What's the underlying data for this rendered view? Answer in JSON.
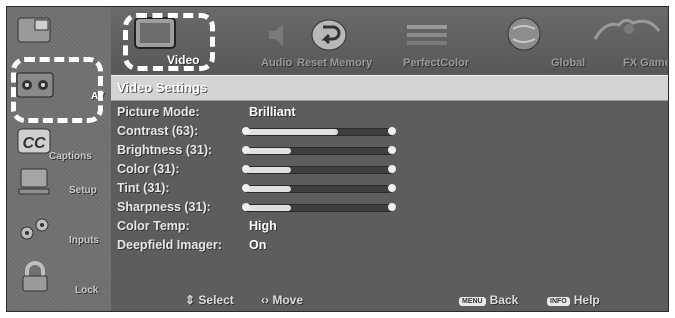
{
  "sidebar": {
    "items": [
      {
        "label": "",
        "icon": "picture-in-picture-icon"
      },
      {
        "label": "AV",
        "icon": "av-inputs-icon"
      },
      {
        "label": "Captions",
        "icon": "cc-icon"
      },
      {
        "label": "Setup",
        "icon": "computer-icon"
      },
      {
        "label": "Inputs",
        "icon": "inputs-icon"
      },
      {
        "label": "Lock",
        "icon": "lock-icon"
      }
    ]
  },
  "topbar": {
    "items": [
      {
        "label": "Video",
        "icon": "video-monitor-icon"
      },
      {
        "label": "Audio",
        "icon": "audio-icon"
      },
      {
        "label": "Reset Memory",
        "icon": "reset-icon"
      },
      {
        "label": "PerfectColor",
        "icon": "perfect-color-icon"
      },
      {
        "label": "Global",
        "icon": "global-icon"
      },
      {
        "label": "FX Games",
        "icon": "fx-games-icon"
      }
    ]
  },
  "header": {
    "title": "Video Settings"
  },
  "settings": [
    {
      "name": "Picture Mode:",
      "value": "Brilliant",
      "type": "text"
    },
    {
      "name": "Contrast (63):",
      "level": 0.63,
      "type": "slider"
    },
    {
      "name": "Brightness (31):",
      "level": 0.31,
      "type": "slider"
    },
    {
      "name": "Color (31):",
      "level": 0.31,
      "type": "slider"
    },
    {
      "name": "Tint (31):",
      "level": 0.31,
      "type": "slider"
    },
    {
      "name": "Sharpness (31):",
      "level": 0.31,
      "type": "slider"
    },
    {
      "name": "Color Temp:",
      "value": "High",
      "type": "text"
    },
    {
      "name": "Deepfield Imager:",
      "value": "On",
      "type": "text"
    }
  ],
  "footer": {
    "select_label": "Select",
    "move_label": "Move",
    "back_key": "MENU",
    "back_label": "Back",
    "help_key": "INFO",
    "help_label": "Help"
  },
  "colors": {
    "background": "#5d5d5d",
    "header_band": "#d4d4d4",
    "highlight_ring": "#ffffff"
  }
}
